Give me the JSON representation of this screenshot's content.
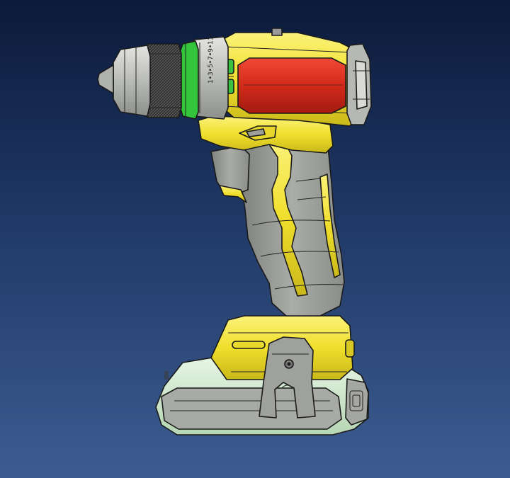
{
  "colors": {
    "background_top": "#0c1a3a",
    "background_bottom": "#3c5c90",
    "housing_yellow": "#f2e23a",
    "grip_grey": "#9c9f9a",
    "accent_red": "#d42a1c",
    "accent_green": "#33c43b",
    "battery_mint": "#cfe8cf",
    "chuck_silver": "#c8cac6"
  },
  "scene": {
    "model": "cordless-drill-cad-model",
    "view": "side-orthographic"
  }
}
